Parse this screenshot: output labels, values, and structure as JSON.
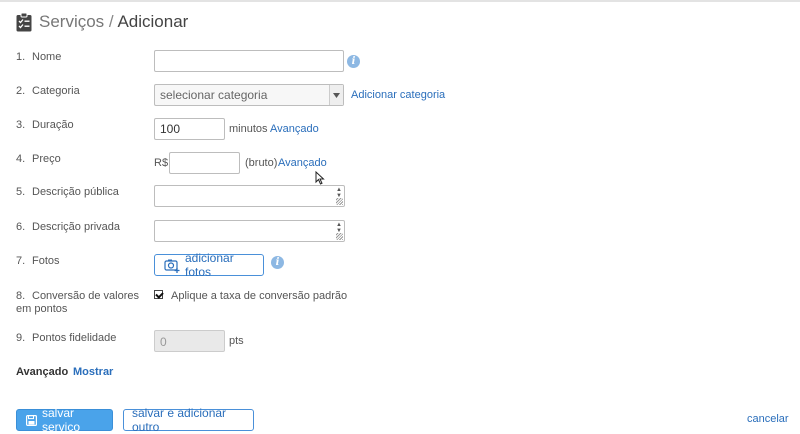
{
  "header": {
    "section": "Serviços",
    "separator": "/",
    "current": "Adicionar"
  },
  "fields": {
    "nome": {
      "num": "1.",
      "label": "Nome",
      "value": ""
    },
    "categoria": {
      "num": "2.",
      "label": "Categoria",
      "selected": "selecionar categoria",
      "add_link": "Adicionar categoria"
    },
    "duracao": {
      "num": "3.",
      "label": "Duração",
      "value": "100",
      "unit": "minutos",
      "advanced_link": "Avançado"
    },
    "preco": {
      "num": "4.",
      "label": "Preço",
      "currency": "R$",
      "value": "",
      "suffix": "(bruto)",
      "advanced_link": "Avançado"
    },
    "descricao_publica": {
      "num": "5.",
      "label": "Descrição pública"
    },
    "descricao_privada": {
      "num": "6.",
      "label": "Descrição privada"
    },
    "fotos": {
      "num": "7.",
      "label": "Fotos",
      "button": "adicionar fotos"
    },
    "conversao": {
      "num": "8.",
      "label": "Conversão de valores em pontos",
      "checkbox_label": "Aplique a taxa de conversão padrão",
      "checked": true
    },
    "pontos": {
      "num": "9.",
      "label": "Pontos fidelidade",
      "placeholder": "0",
      "unit": "pts"
    }
  },
  "advanced": {
    "label": "Avançado",
    "toggle": "Mostrar"
  },
  "actions": {
    "save": "salvar serviço",
    "save_and_add": "salvar e adicionar outro",
    "cancel": "cancelar"
  },
  "colors": {
    "link": "#2a6ebb",
    "primary": "#4aa3ea",
    "info": "#8db8e3"
  }
}
